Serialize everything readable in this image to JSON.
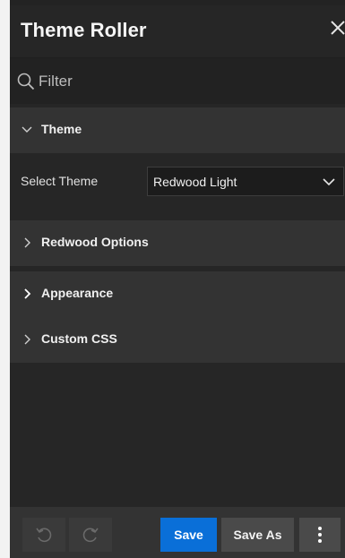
{
  "panel": {
    "title": "Theme Roller"
  },
  "filter": {
    "placeholder": "Filter"
  },
  "sections": [
    {
      "label": "Theme",
      "expanded": true
    },
    {
      "label": "Redwood Options",
      "expanded": false
    },
    {
      "label": "Appearance",
      "expanded": false
    },
    {
      "label": "Custom CSS",
      "expanded": false
    }
  ],
  "theme": {
    "select_label": "Select Theme",
    "selected_value": "Redwood Light"
  },
  "footer": {
    "save_label": "Save",
    "save_as_label": "Save As"
  },
  "icons": {
    "close": "close-icon",
    "filter": "search-icon",
    "undo": "undo-icon",
    "redo": "redo-icon",
    "more": "more-vertical-icon"
  },
  "colors": {
    "accent": "#0a6fd8",
    "panel_bg": "#262626",
    "section_bg": "#333333"
  }
}
